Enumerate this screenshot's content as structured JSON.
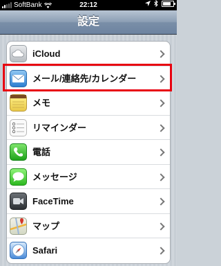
{
  "status": {
    "carrier": "SoftBank",
    "time": "22:12"
  },
  "nav": {
    "title": "設定"
  },
  "items": [
    {
      "label": "iCloud",
      "icon": "icloud-icon"
    },
    {
      "label": "メール/連絡先/カレンダー",
      "icon": "mail-icon"
    },
    {
      "label": "メモ",
      "icon": "notes-icon"
    },
    {
      "label": "リマインダー",
      "icon": "reminders-icon"
    },
    {
      "label": "電話",
      "icon": "phone-icon"
    },
    {
      "label": "メッセージ",
      "icon": "messages-icon"
    },
    {
      "label": "FaceTime",
      "icon": "facetime-icon"
    },
    {
      "label": "マップ",
      "icon": "maps-icon"
    },
    {
      "label": "Safari",
      "icon": "safari-icon"
    }
  ],
  "highlight_color": "#e80010"
}
